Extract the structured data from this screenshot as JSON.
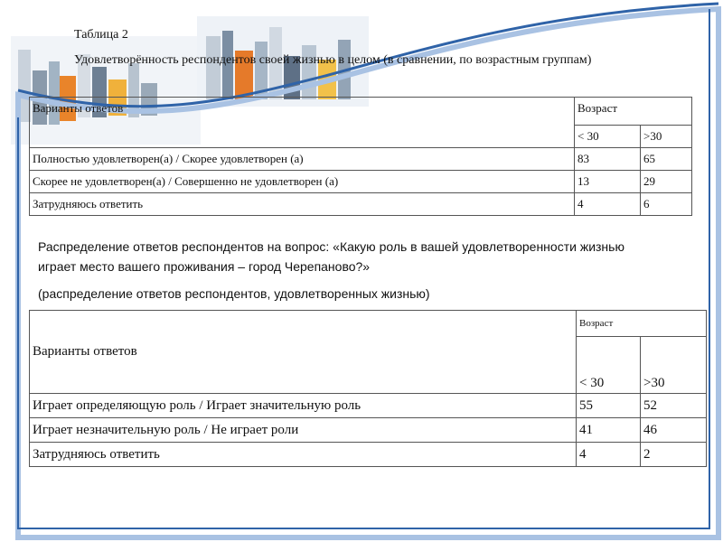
{
  "table1": {
    "caption": "Таблица 2",
    "title": "Удовлетворённость респондентов своей жизнью в целом (в сравнении, по возрастным группам)",
    "col_label": "Варианты ответов",
    "group_label": "Возраст",
    "sub_cols": [
      "< 30",
      ">30"
    ],
    "rows": [
      {
        "label": "Полностью удовлетворен(а) / Скорее удовлетворен (а)",
        "v1": "83",
        "v2": "65"
      },
      {
        "label": "Скорее не удовлетворен(а) / Совершенно не удовлетворен (а)",
        "v1": "13",
        "v2": "29"
      },
      {
        "label": "Затрудняюсь ответить",
        "v1": "4",
        "v2": "6"
      }
    ]
  },
  "table2": {
    "title": "Распределение ответов респондентов на вопрос: «Какую роль в вашей удовлетворенности жизнью играет место вашего проживания – город Черепаново?»",
    "subtitle": "(распределение ответов респондентов, удовлетворенных жизнью)",
    "col_label": "Варианты ответов",
    "group_label": "Возраст",
    "sub_cols": [
      "< 30",
      ">30"
    ],
    "rows": [
      {
        "label": "Играет определяющую роль / Играет значительную роль",
        "v1": "55",
        "v2": "52"
      },
      {
        "label": "Играет незначительную роль / Не играет роли",
        "v1": "41",
        "v2": "46"
      },
      {
        "label": "Затрудняюсь ответить",
        "v1": "4",
        "v2": "2"
      }
    ]
  },
  "colors": {
    "frame": "#2f63a8",
    "frame_light": "#a9c2e3"
  }
}
